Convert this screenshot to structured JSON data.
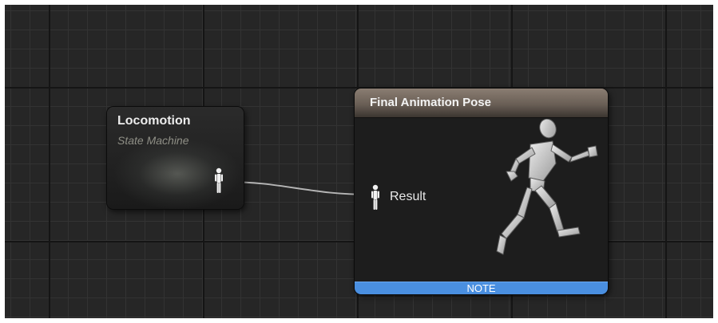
{
  "graph": {
    "nodes": {
      "locomotion": {
        "title": "Locomotion",
        "subtitle": "State Machine",
        "output_pin_icon": "pose-pin-icon"
      },
      "final_pose": {
        "title": "Final Animation Pose",
        "input_label": "Result",
        "input_pin_icon": "pose-pin-icon",
        "preview_icon": "running-mannequin-icon",
        "note_label": "NOTE"
      }
    }
  },
  "colors": {
    "graph_background": "#262626",
    "header_accent": "#7a6e63",
    "note_bar": "#4a8fe0",
    "wire": "#cfcfcf"
  }
}
